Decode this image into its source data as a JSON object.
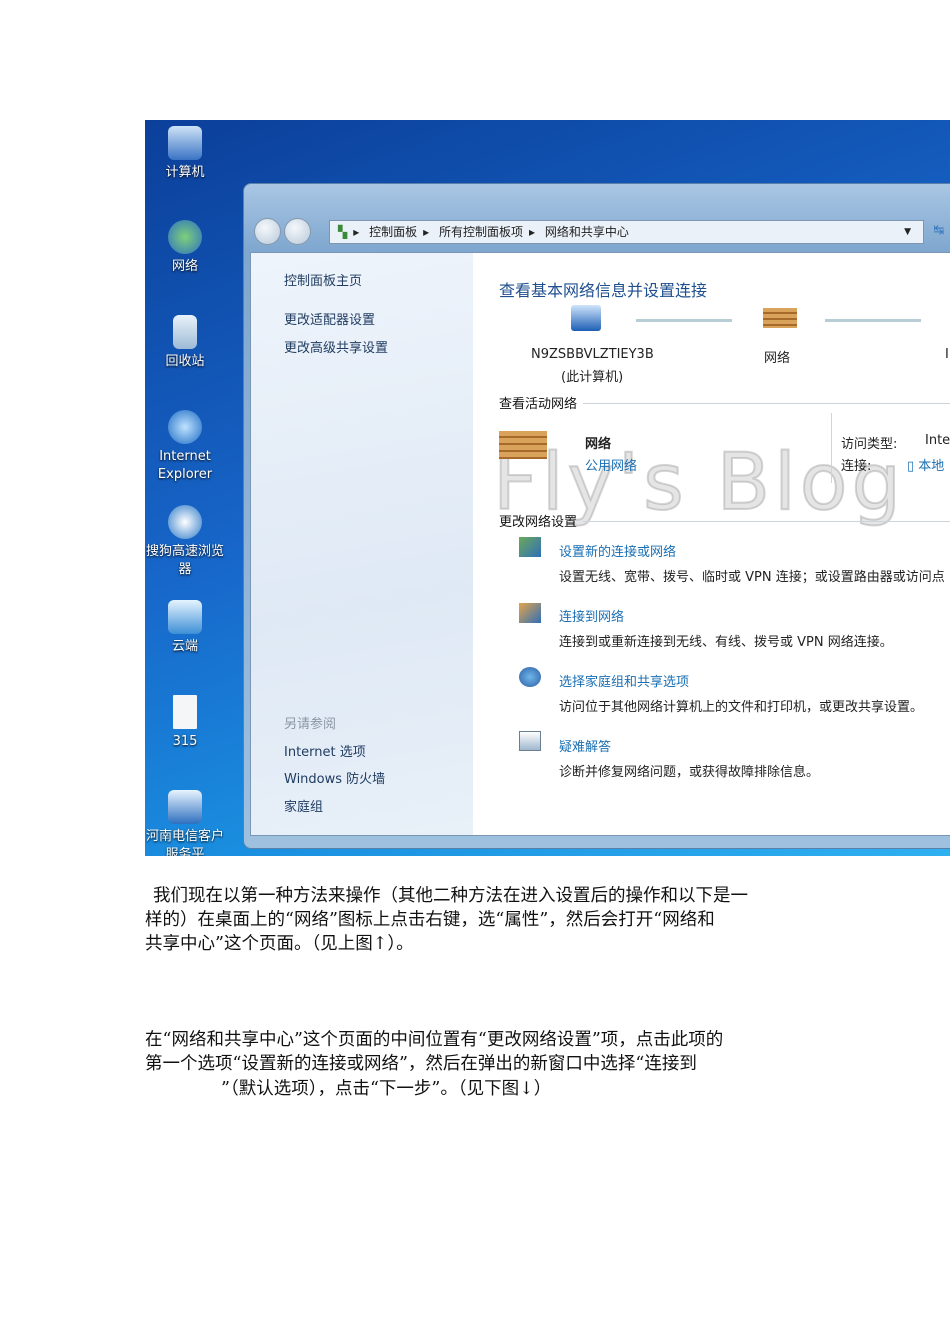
{
  "desktop_icons": [
    {
      "label": "计算机",
      "icon": "computer-icon"
    },
    {
      "label": "网络",
      "icon": "network-icon"
    },
    {
      "label": "回收站",
      "icon": "recycle-bin-icon"
    },
    {
      "label": "Internet Explorer",
      "icon": "ie-icon"
    },
    {
      "label": "搜狗高速浏览器",
      "icon": "sogou-browser-icon"
    },
    {
      "label": "云端",
      "icon": "cloud-icon"
    },
    {
      "label": "315",
      "icon": "document-icon"
    },
    {
      "label": "河南电信客户服务平",
      "icon": "telecom-icon"
    }
  ],
  "address_bar": {
    "crumbs": [
      "控制面板",
      "所有控制面板项",
      "网络和共享中心"
    ]
  },
  "left_pane": {
    "home": "控制面板主页",
    "links": [
      "更改适配器设置",
      "更改高级共享设置"
    ],
    "see_also_title": "另请参阅",
    "see_also": [
      "Internet 选项",
      "Windows 防火墙",
      "家庭组"
    ]
  },
  "main": {
    "title": "查看基本网络信息并设置连接",
    "map": {
      "computer_name": "N9ZSBBVLZTIEY3B",
      "computer_sub": "(此计算机)",
      "network": "网络",
      "internet": "In"
    },
    "active_title": "查看活动网络",
    "active": {
      "name": "网络",
      "type": "公用网络",
      "access_label": "访问类型:",
      "access_value": "Inte",
      "conn_label": "连接:",
      "conn_value": "本地"
    },
    "change_title": "更改网络设置",
    "tasks": [
      {
        "title": "设置新的连接或网络",
        "desc": "设置无线、宽带、拨号、临时或 VPN 连接；或设置路由器或访问点"
      },
      {
        "title": "连接到网络",
        "desc": "连接到或重新连接到无线、有线、拨号或 VPN 网络连接。"
      },
      {
        "title": "选择家庭组和共享选项",
        "desc": "访问位于其他网络计算机上的文件和打印机，或更改共享设置。"
      },
      {
        "title": "疑难解答",
        "desc": "诊断并修复网络问题，或获得故障排除信息。"
      }
    ]
  },
  "watermark": "Fly's Blog",
  "paragraphs": [
    [
      "我们现在以第一种方法来操作（其他二种方法在进入设置后的操作和以下是一",
      "样的）在桌面上的“网络”图标上点击右键，选“属性”，然后会打开“网络和",
      "共享中心”这个页面。（见上图↑）。"
    ],
    [
      "在“网络和共享中心”这个页面的中间位置有“更改网络设置”项，点击此项的",
      "第一个选项“设置新的连接或网络”，然后在弹出的新窗口中选择“连接到",
      "”（默认选项），点击“下一步”。（见下图↓）"
    ]
  ]
}
